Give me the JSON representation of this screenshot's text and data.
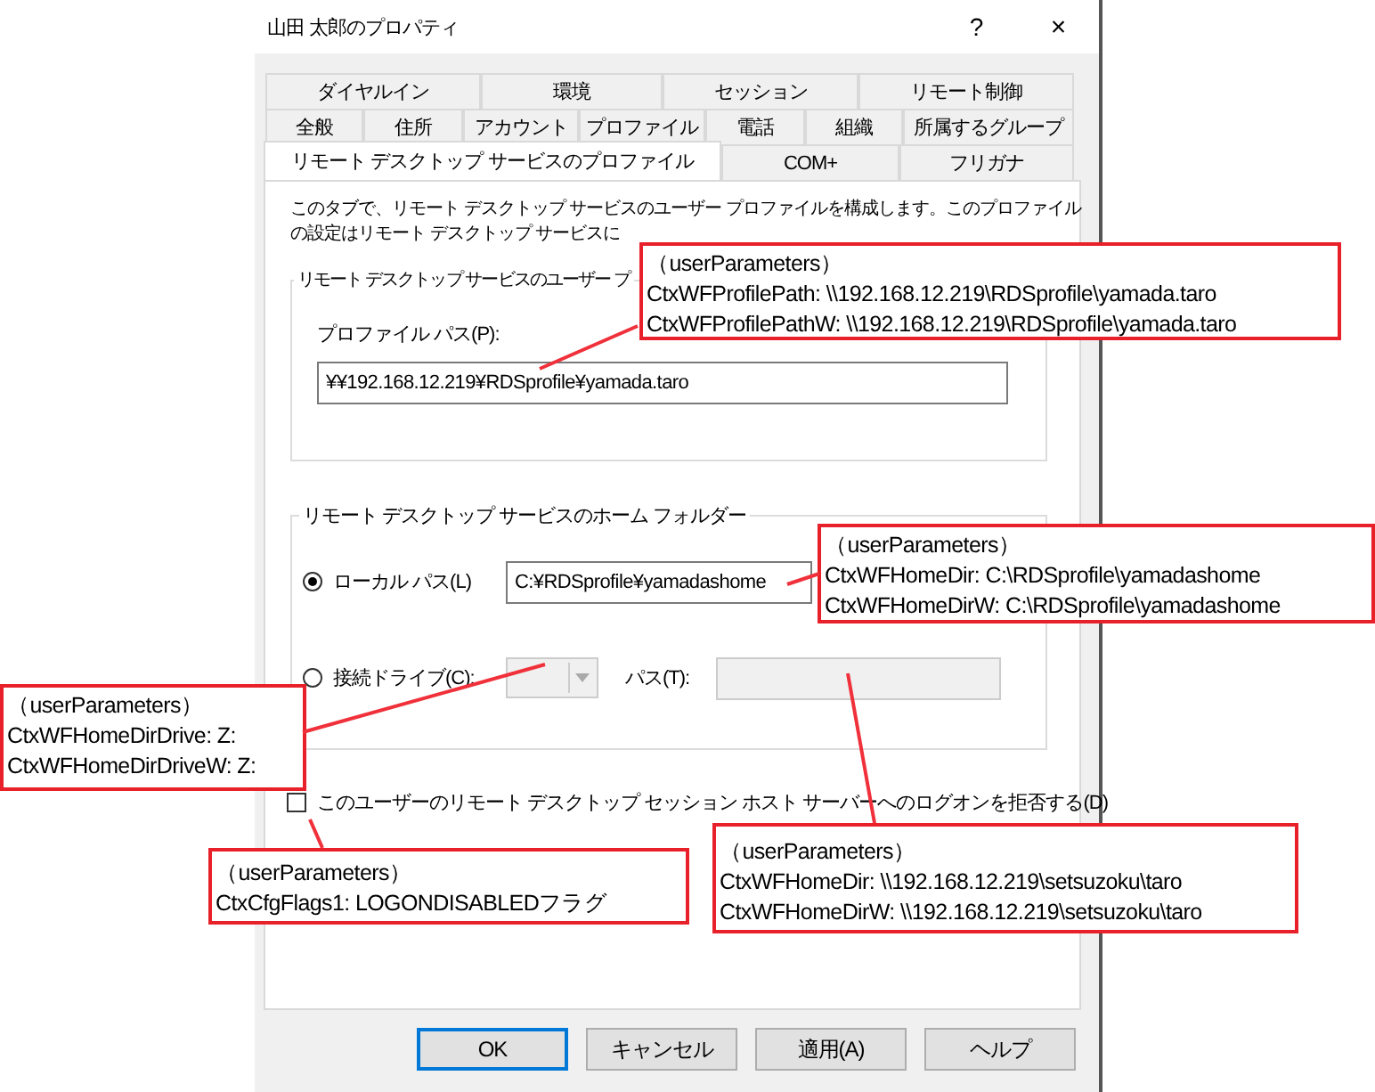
{
  "window": {
    "title": "山田 太郎のプロパティ",
    "help_button": "?",
    "close_button": "×"
  },
  "tab_rows": [
    {
      "tabs": [
        {
          "label": "ダイヤルイン",
          "selected": false
        },
        {
          "label": "環境",
          "selected": false
        },
        {
          "label": "セッション",
          "selected": false
        },
        {
          "label": "リモート制御",
          "selected": false
        }
      ]
    },
    {
      "tabs": [
        {
          "label": "全般",
          "selected": false
        },
        {
          "label": "住所",
          "selected": false
        },
        {
          "label": "アカウント",
          "selected": false
        },
        {
          "label": "プロファイル",
          "selected": false
        },
        {
          "label": "電話",
          "selected": false
        },
        {
          "label": "組織",
          "selected": false
        },
        {
          "label": "所属するグループ",
          "selected": false
        }
      ]
    },
    {
      "tabs": [
        {
          "label": "リモート デスクトップ サービスのプロファイル",
          "selected": true
        },
        {
          "label": "COM+",
          "selected": false
        },
        {
          "label": "フリガナ",
          "selected": false
        }
      ]
    }
  ],
  "panel": {
    "description": "このタブで、リモート デスクトップ サービスのユーザー プロファイルを構成します。このプロファイルの設定はリモート デスクトップ サービスに",
    "profile_group": {
      "legend": "リモート デスクトップ サービスのユーザー プ",
      "path_label": "プロファイル パス(P):",
      "path_value": "¥¥192.168.12.219¥RDSprofile¥yamada.taro"
    },
    "home_group": {
      "legend": "リモート デスクトップ サービスのホーム フォルダー",
      "options": [
        {
          "kind": "local",
          "label": "ローカル パス(L)",
          "selected": true,
          "value": "C:¥RDSprofile¥yamadashome"
        },
        {
          "kind": "drive",
          "label": "接続ドライブ(C):",
          "selected": false,
          "path_label": "パス(T):"
        }
      ]
    },
    "deny_logon": {
      "label": "このユーザーのリモート デスクトップ セッション ホスト サーバーへのログオンを拒否する(D)",
      "checked": false
    }
  },
  "buttons": [
    {
      "label": "OK",
      "default": true
    },
    {
      "label": "キャンセル",
      "default": false
    },
    {
      "label": "適用(A)",
      "default": false
    },
    {
      "label": "ヘルプ",
      "default": false
    }
  ],
  "callouts": [
    {
      "lines": [
        "（userParameters）",
        "CtxWFProfilePath: \\\\192.168.12.219\\RDSprofile\\yamada.taro",
        "CtxWFProfilePathW: \\\\192.168.12.219\\RDSprofile\\yamada.taro"
      ]
    },
    {
      "lines": [
        "（userParameters）",
        "CtxWFHomeDir: C:\\RDSprofile\\yamadashome",
        "CtxWFHomeDirW: C:\\RDSprofile\\yamadashome"
      ]
    },
    {
      "lines": [
        "（userParameters）",
        "CtxWFHomeDirDrive: Z:",
        "CtxWFHomeDirDriveW: Z:"
      ]
    },
    {
      "lines": [
        "（userParameters）",
        "CtxCfgFlags1: LOGONDISABLEDフラグ"
      ]
    },
    {
      "lines": [
        "（userParameters）",
        "CtxWFHomeDir: \\\\192.168.12.219\\setsuzoku\\taro",
        "CtxWFHomeDirW: \\\\192.168.12.219\\setsuzoku\\taro"
      ]
    }
  ]
}
